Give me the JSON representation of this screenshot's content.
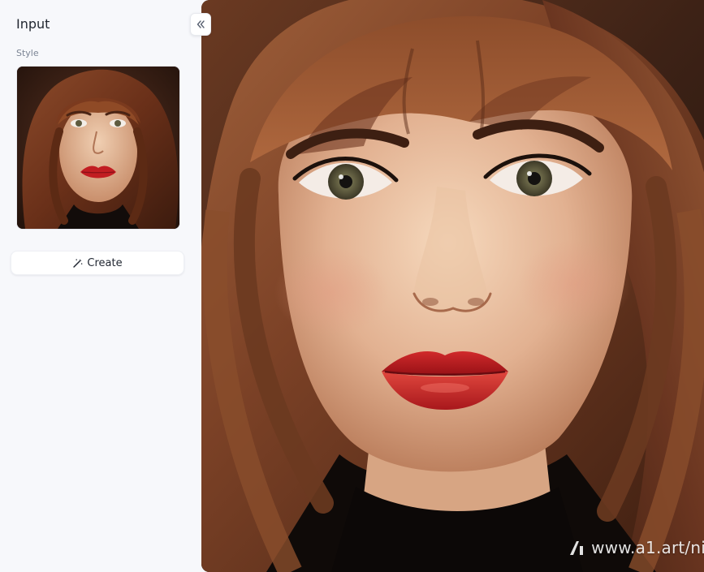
{
  "panel": {
    "title": "Input",
    "style_label": "Style"
  },
  "actions": {
    "create_label": "Create"
  },
  "icons": {
    "collapse": "double-chevron-left-icon",
    "create": "magic-wand-icon",
    "watermark_logo": "a1-logo-icon"
  },
  "result": {
    "watermark_text": "www.a1.art/ni"
  },
  "colors": {
    "sidebar_bg": "#f7f8fb",
    "lip_red": "#c21d22",
    "hair_brown": "#7a3f22"
  }
}
